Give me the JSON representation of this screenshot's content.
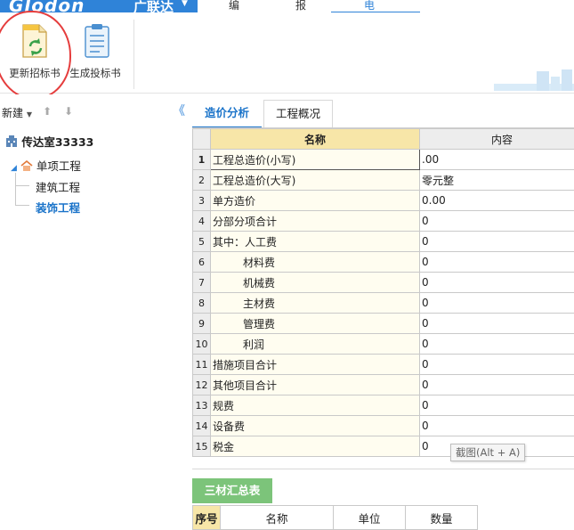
{
  "header": {
    "brand_logo": "Glodon",
    "brand_cn": "广联达",
    "menu_tabs": [
      {
        "label": "编制"
      },
      {
        "label": "报表"
      },
      {
        "label": "电子标"
      }
    ],
    "active_tab": "电子标",
    "accent_color": "#2f83d8"
  },
  "ribbon": {
    "update_label": "更新招标书",
    "generate_label": "生成投标书"
  },
  "left_pane": {
    "new_label": "新建",
    "root": "传达室33333",
    "unit": "单项工程",
    "children": [
      "建筑工程",
      "装饰工程"
    ],
    "selected_child": "装饰工程"
  },
  "tabs": {
    "analysis": "造价分析",
    "overview": "工程概况"
  },
  "grid": {
    "headers": [
      "名称",
      "内容"
    ],
    "rows": [
      {
        "no": "1",
        "name": "工程总造价(小写)",
        "value": ".00"
      },
      {
        "no": "2",
        "name": "工程总造价(大写)",
        "value": "零元整"
      },
      {
        "no": "3",
        "name": "单方造价",
        "value": "0.00"
      },
      {
        "no": "4",
        "name": "分部分项合计",
        "value": "0"
      },
      {
        "no": "5",
        "name": "其中：人工费",
        "value": "0"
      },
      {
        "no": "6",
        "name": "材料费",
        "value": "0"
      },
      {
        "no": "7",
        "name": "机械费",
        "value": "0"
      },
      {
        "no": "8",
        "name": "主材费",
        "value": "0"
      },
      {
        "no": "9",
        "name": "管理费",
        "value": "0"
      },
      {
        "no": "10",
        "name": "利润",
        "value": "0"
      },
      {
        "no": "11",
        "name": "措施项目合计",
        "value": "0"
      },
      {
        "no": "12",
        "name": "其他项目合计",
        "value": "0"
      },
      {
        "no": "13",
        "name": "规费",
        "value": "0"
      },
      {
        "no": "14",
        "name": "设备费",
        "value": "0"
      },
      {
        "no": "15",
        "name": "税金",
        "value": "0"
      }
    ]
  },
  "tooltip": "截图(Alt + A)",
  "summary": {
    "tab": "三材汇总表",
    "headers": [
      "序号",
      "名称",
      "单位",
      "数量"
    ]
  }
}
